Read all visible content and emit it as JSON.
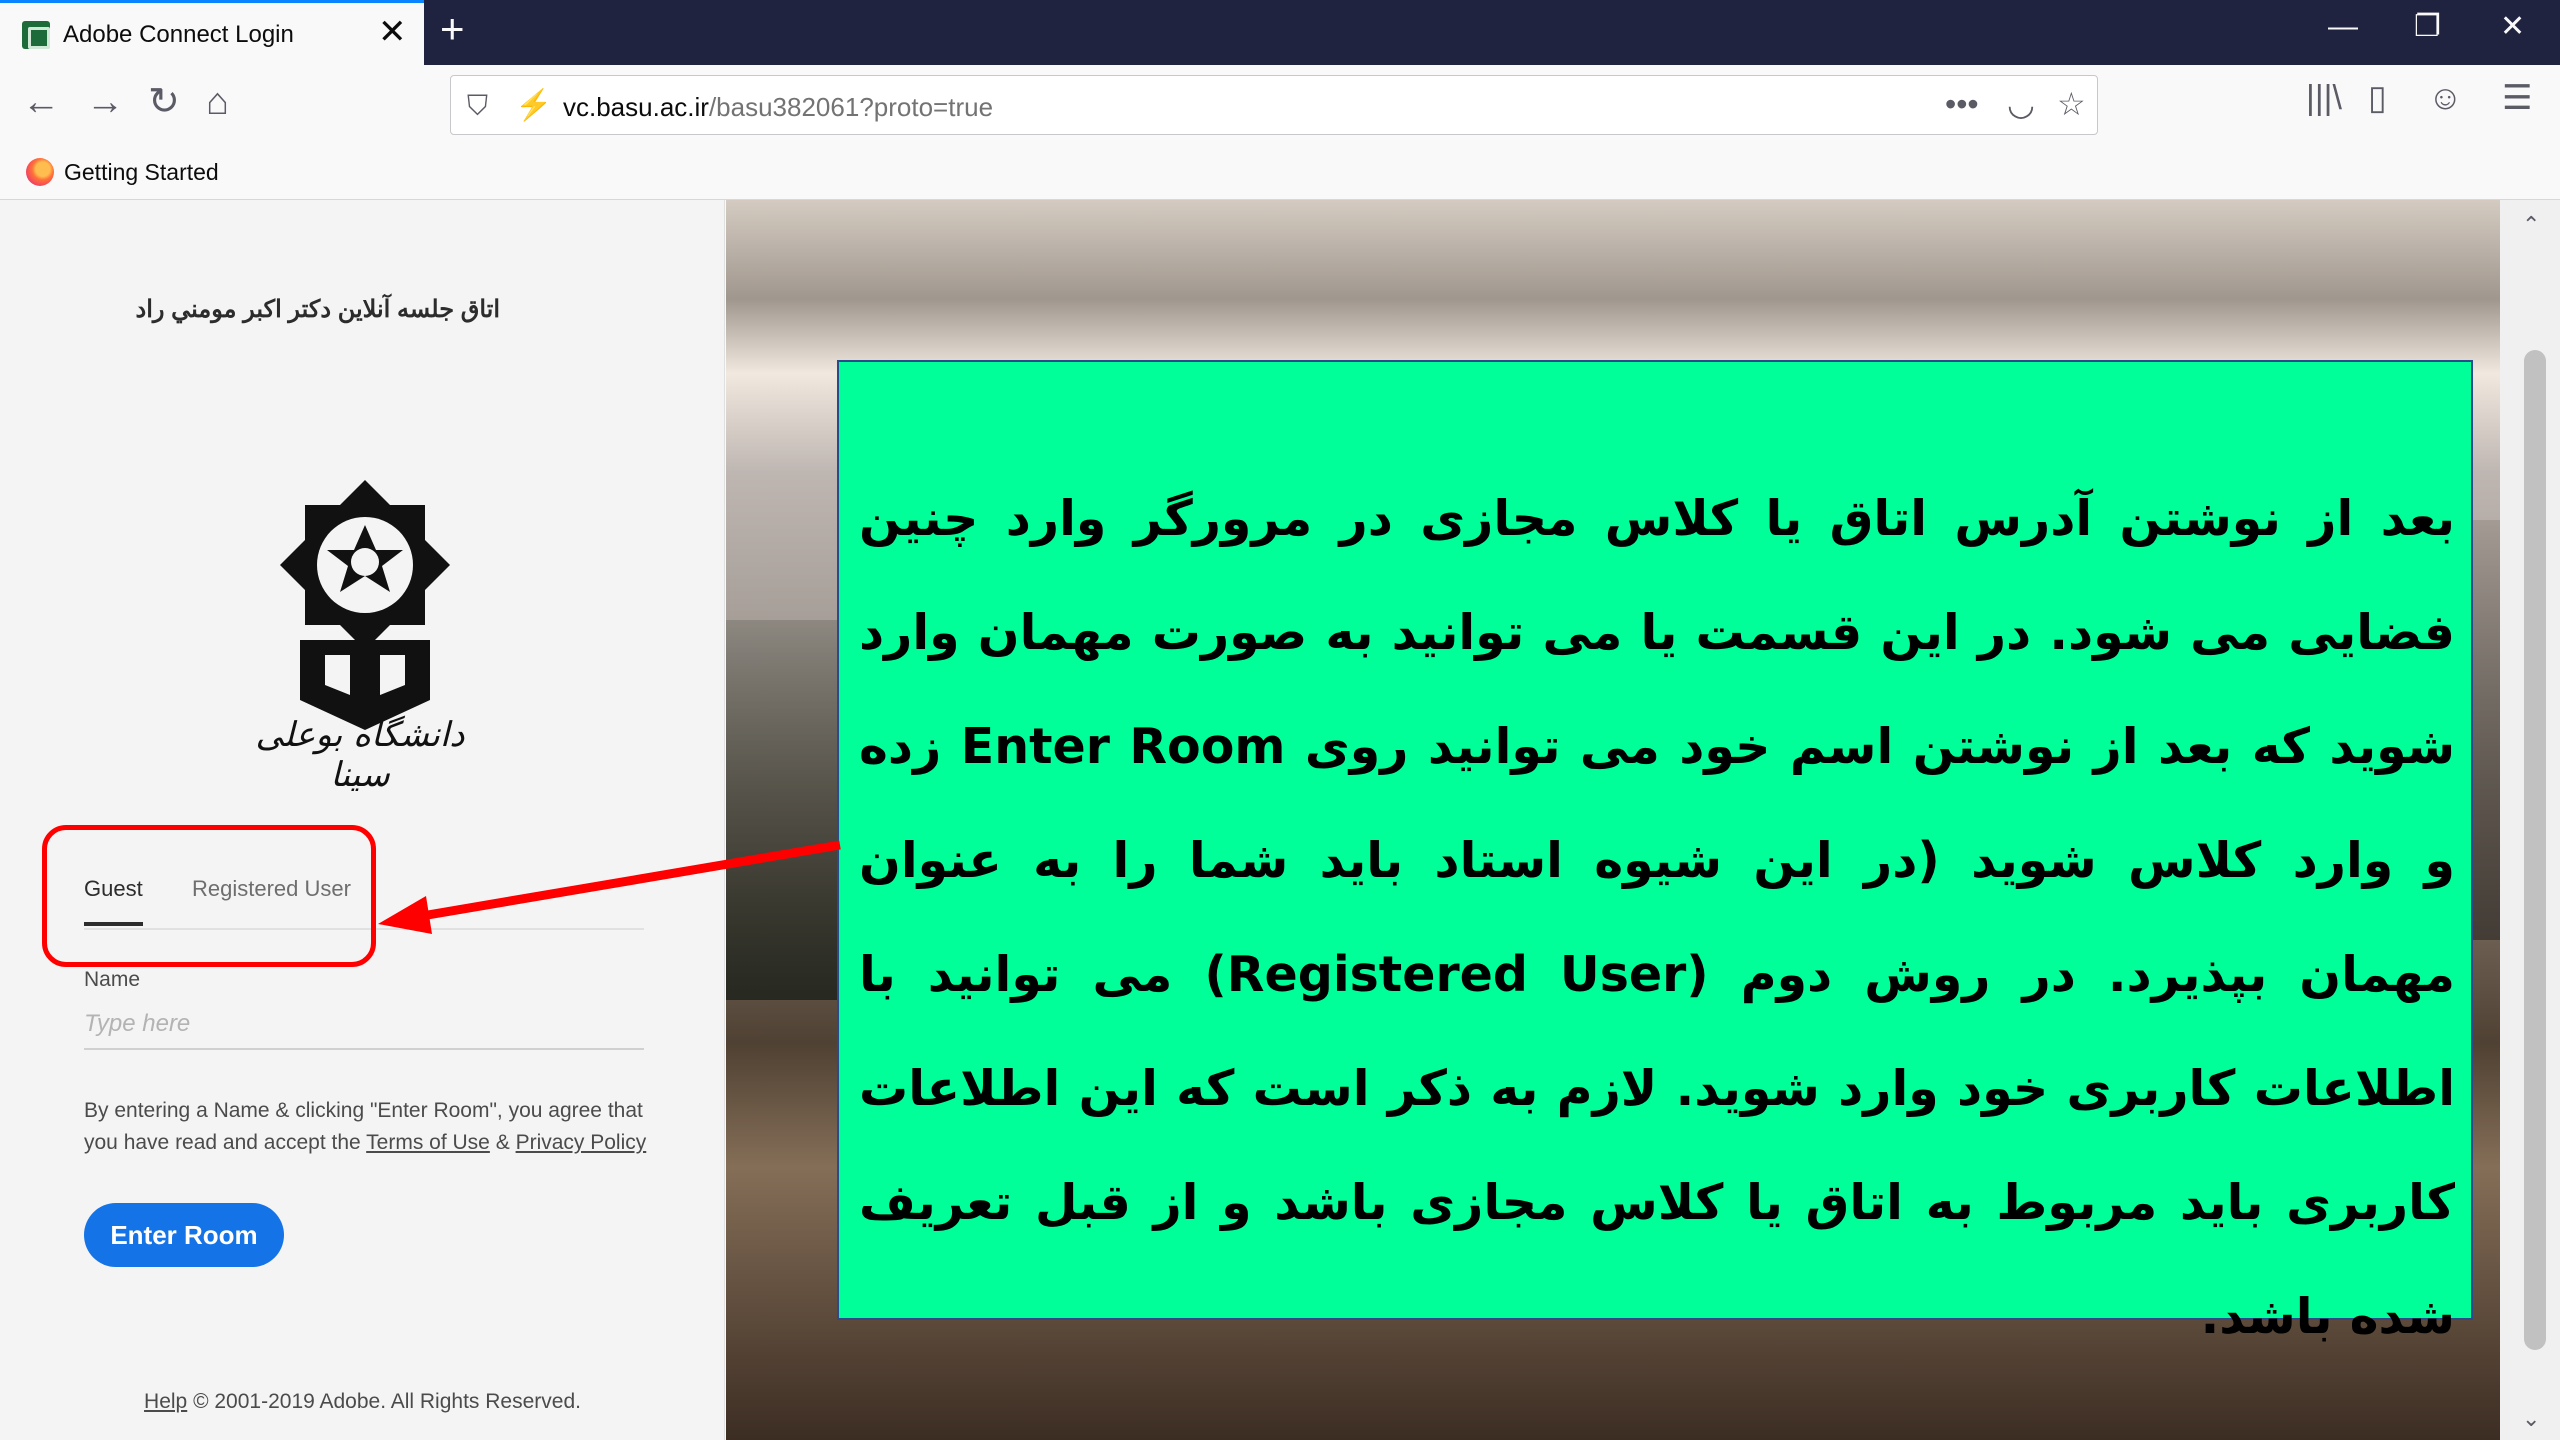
{
  "browser": {
    "tab_title": "Adobe Connect Login",
    "tab_close": "✕",
    "new_tab": "+",
    "window": {
      "minimize": "—",
      "restore": "❐",
      "close": "✕"
    },
    "nav": {
      "back": "←",
      "forward": "→",
      "reload": "↻",
      "home": "⌂"
    },
    "url": {
      "host": "vc.basu.ac.ir",
      "path": "/basu382061?proto=true",
      "shield_icon": "⛉",
      "insecure_icon": "⚡"
    },
    "url_actions": {
      "more": "•••",
      "pocket": "◡",
      "bookmark": "☆"
    },
    "toolbar": {
      "library": "|||\\",
      "sidebar": "▯",
      "account": "☺",
      "menu": "☰"
    },
    "bookmark_item": "Getting Started"
  },
  "page": {
    "room_title": "اتاق جلسه آنلاین دکتر اکبر مومني راد",
    "logo_caption": "دانشگاه بوعلی سینا",
    "tabs": {
      "guest": "Guest",
      "registered": "Registered User"
    },
    "name_label": "Name",
    "name_placeholder": "Type here",
    "consent": {
      "prefix": "By entering a Name & clicking \"Enter Room\", you agree that you have read and accept the ",
      "terms": "Terms of Use",
      "amp": " & ",
      "privacy": "Privacy Policy"
    },
    "enter_button": "Enter Room",
    "footer": {
      "help": "Help",
      "copyright": " © 2001-2019 Adobe. All Rights Reserved."
    }
  },
  "annotation": {
    "text": "بعد از نوشتن آدرس اتاق یا کلاس مجازی در مرورگر وارد چنین فضایی می شود. در این قسمت یا می توانید به صورت مهمان وارد شوید که بعد از نوشتن اسم خود می توانید روی Enter Room زده و وارد کلاس شوید (در این شیوه استاد باید شما را به عنوان مهمان بپذیرد. در روش دوم (Registered User) می توانید با اطلاعات کاربری خود وارد شوید. لازم به ذکر است که این اطلاعات کاربری باید مربوط به اتاق یا کلاس مجازی باشد و از قبل تعریف شده باشد."
  },
  "scrollbar": {
    "up": "⌃",
    "down": "⌄"
  },
  "colors": {
    "accent": "#1473e6",
    "annotation_bg": "#00ff99",
    "highlight": "#ff0000",
    "tabbar": "#202340"
  }
}
